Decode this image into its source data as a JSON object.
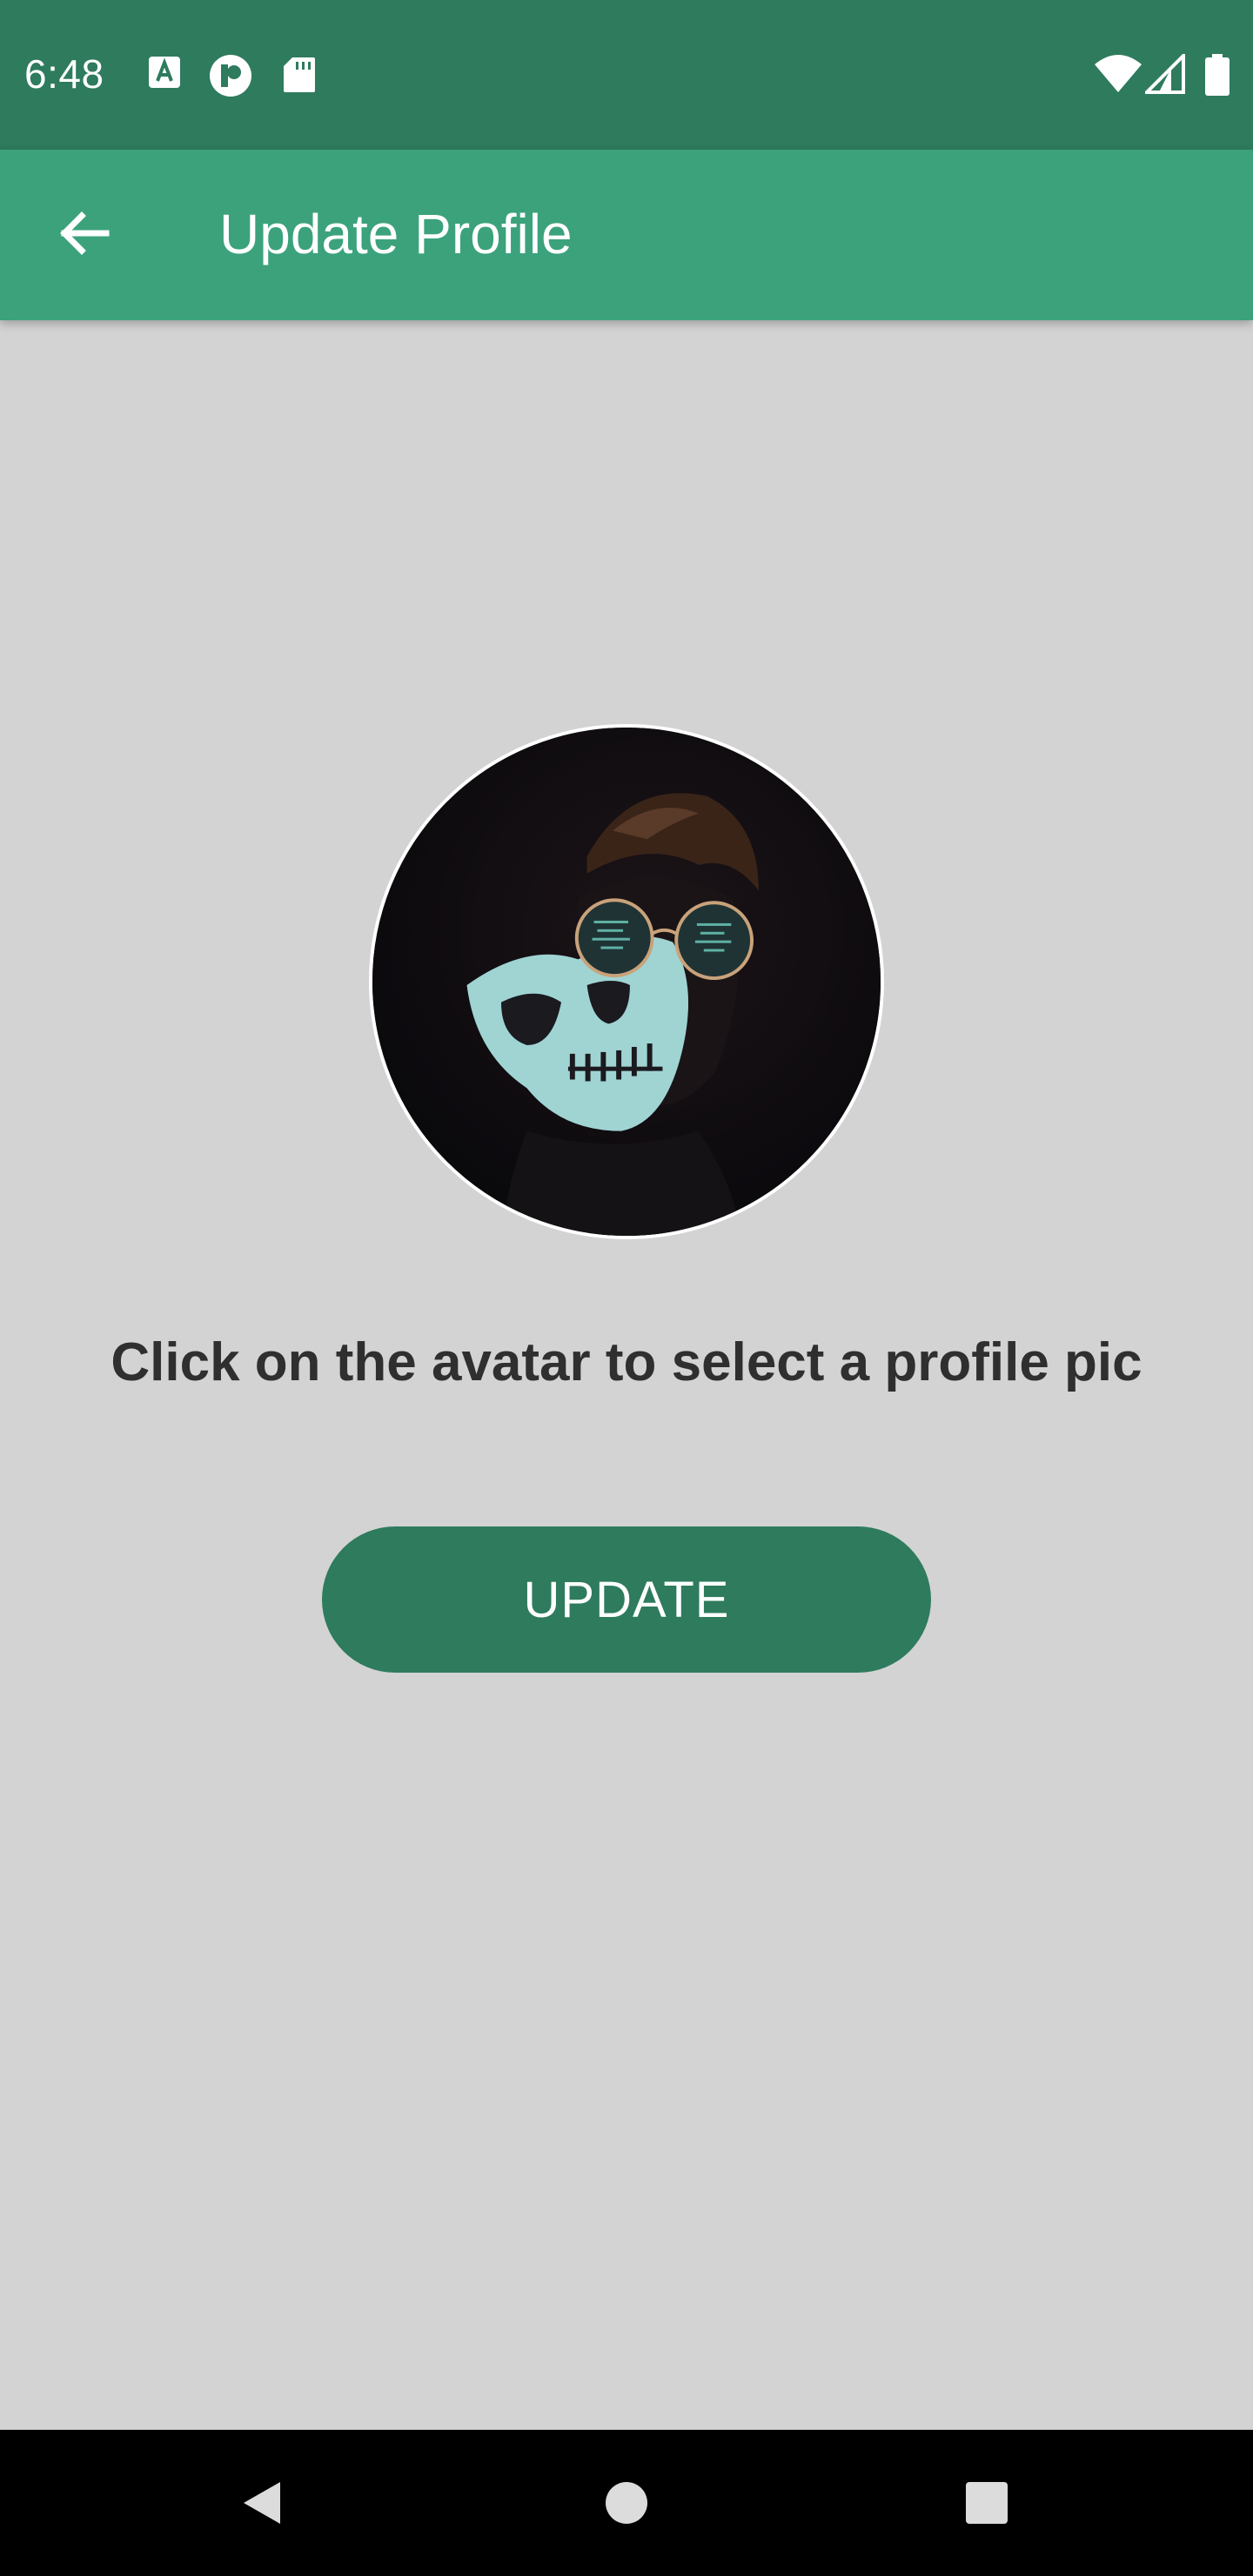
{
  "status_bar": {
    "time": "6:48",
    "icons": [
      "a-icon",
      "p-icon",
      "sd-card-icon",
      "wifi-icon",
      "signal-icon",
      "battery-icon"
    ]
  },
  "app_bar": {
    "title": "Update Profile",
    "back_icon": "arrow-left-icon"
  },
  "main": {
    "hint": "Click on the avatar to select a profile pic",
    "update_label": "UPDATE"
  },
  "nav_bar": {
    "icons": [
      "nav-back-icon",
      "nav-home-icon",
      "nav-recents-icon"
    ]
  },
  "colors": {
    "status_bar": "#2e7b5e",
    "app_bar": "#3ba27c",
    "background": "#d3d3d3",
    "button": "#2e7b5e"
  }
}
